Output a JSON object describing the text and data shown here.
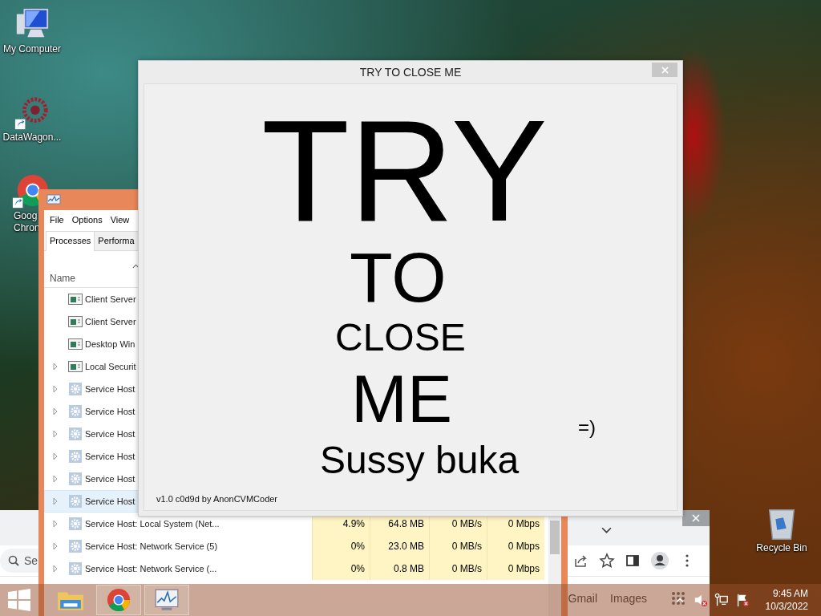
{
  "desktop_icons": [
    {
      "kind": "computer",
      "lines": [
        "My Computer"
      ]
    },
    {
      "kind": "shortcut",
      "lines": [
        "DataWagon..."
      ]
    },
    {
      "kind": "chrome",
      "lines": [
        "Goog",
        "Chron"
      ]
    },
    {
      "kind": "bin",
      "lines": [
        "Recycle Bin"
      ]
    }
  ],
  "browser_window": {
    "search": {
      "placeholder": "Se"
    },
    "links": [
      "Gmail",
      "Images"
    ]
  },
  "task_manager": {
    "menu": [
      "File",
      "Options",
      "View"
    ],
    "tabs": [
      {
        "label": "Processes",
        "selected": true
      },
      {
        "label": "Performa",
        "selected": false
      }
    ],
    "name_column": "Name",
    "rows": [
      {
        "name": "Client Server",
        "kind": "window",
        "expandable": false,
        "selected": false
      },
      {
        "name": "Client Server",
        "kind": "window",
        "expandable": false,
        "selected": false
      },
      {
        "name": "Desktop Win",
        "kind": "window",
        "expandable": false,
        "selected": false
      },
      {
        "name": "Local Securit",
        "kind": "window",
        "expandable": true,
        "selected": false
      },
      {
        "name": "Service Host",
        "kind": "service",
        "expandable": true,
        "selected": false
      },
      {
        "name": "Service Host",
        "kind": "service",
        "expandable": true,
        "selected": false
      },
      {
        "name": "Service Host",
        "kind": "service",
        "expandable": true,
        "selected": false
      },
      {
        "name": "Service Host",
        "kind": "service",
        "expandable": true,
        "selected": false
      },
      {
        "name": "Service Host",
        "kind": "service",
        "expandable": true,
        "selected": false
      },
      {
        "name": "Service Host",
        "kind": "service",
        "expandable": true,
        "selected": true
      },
      {
        "name": "Service Host: Local System (Net...",
        "kind": "service",
        "expandable": true,
        "selected": false,
        "cpu": "4.9%",
        "memory": "64.8 MB",
        "disk": "0 MB/s",
        "network": "0 Mbps"
      },
      {
        "name": "Service Host: Network Service (5)",
        "kind": "service",
        "expandable": true,
        "selected": false,
        "cpu": "0%",
        "memory": "23.0 MB",
        "disk": "0 MB/s",
        "network": "0 Mbps"
      },
      {
        "name": "Service Host: Network Service (...",
        "kind": "service",
        "expandable": true,
        "selected": false,
        "cpu": "0%",
        "memory": "0.8 MB",
        "disk": "0 MB/s",
        "network": "0 Mbps"
      }
    ]
  },
  "dialog": {
    "title": "TRY TO CLOSE ME",
    "labels": [
      {
        "text": "TRY",
        "kind": "try"
      },
      {
        "text": "TO",
        "kind": "to"
      },
      {
        "text": "CLOSE",
        "kind": "close"
      },
      {
        "text": "ME",
        "kind": "me"
      },
      {
        "text": "=)",
        "kind": "smiley"
      },
      {
        "text": "Sussy buka",
        "kind": "name"
      }
    ],
    "footer": "v1.0 c0d9d by AnonCVMCoder"
  },
  "taskbar": {
    "apps": [
      {
        "kind": "explorer",
        "running": false
      },
      {
        "kind": "chrome",
        "running": true
      },
      {
        "kind": "taskmgr",
        "running": true
      }
    ],
    "time": "9:45 AM",
    "date": "10/3/2022"
  }
}
